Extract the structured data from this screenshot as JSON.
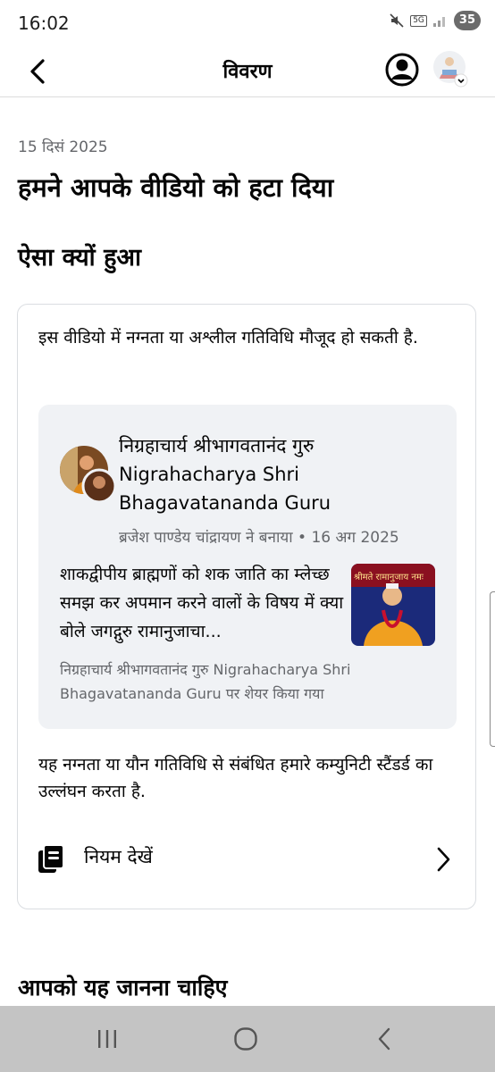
{
  "status_bar": {
    "time": "16:02",
    "network": "5G",
    "battery": "35"
  },
  "header": {
    "title": "विवरण",
    "back_icon": "chevron-left-icon",
    "profile_icon": "account-circle-icon",
    "avatar_icon": "user-avatar"
  },
  "main": {
    "date": "15 दिसं 2025",
    "headline": "हमने आपके वीडियो को हटा दिया",
    "why_heading": "ऐसा क्यों हुआ",
    "reason": "इस वीडियो में नग्नता या अश्लील गतिविधि मौजूद हो सकती है.",
    "post": {
      "author": "निग्रहाचार्य श्रीभागवतानंद गुरु Nigrahacharya Shri Bhagavatananda Guru",
      "meta": "ब्रजेश पाण्डेय चांद्रायण ने बनाया • 16 अग 2025",
      "text": "शाकद्वीपीय ब्राह्मणों को शक जाति का म्लेच्छ समझ कर अपमान करने वालों के विषय में क्या बोले जगद्गुरु रामानुजाचा...",
      "shared": "निग्रहाचार्य श्रीभागवतानंद गुरु Nigrahacharya Shri Bhagavatananda Guru पर शेयर किया गया",
      "thumb_banner": "श्रीमते रामानुजाय नमः"
    },
    "policy_text": "यह नग्नता या यौन गतिविधि से संबंधित हमारे कम्युनिटी स्टैंडर्ड का उल्लंघन करता है.",
    "rules_label": "नियम देखें",
    "rules_icon": "book-icon",
    "know_heading": "आपको यह जानना चाहिए"
  },
  "nav_bar": {
    "items": [
      "recents-icon",
      "home-icon",
      "back-icon"
    ]
  },
  "colors": {
    "text": "#050505",
    "secondary": "#65676b",
    "post_bg": "#f0f2f5",
    "border": "#dadde1",
    "navbar": "#c4c4c4"
  }
}
